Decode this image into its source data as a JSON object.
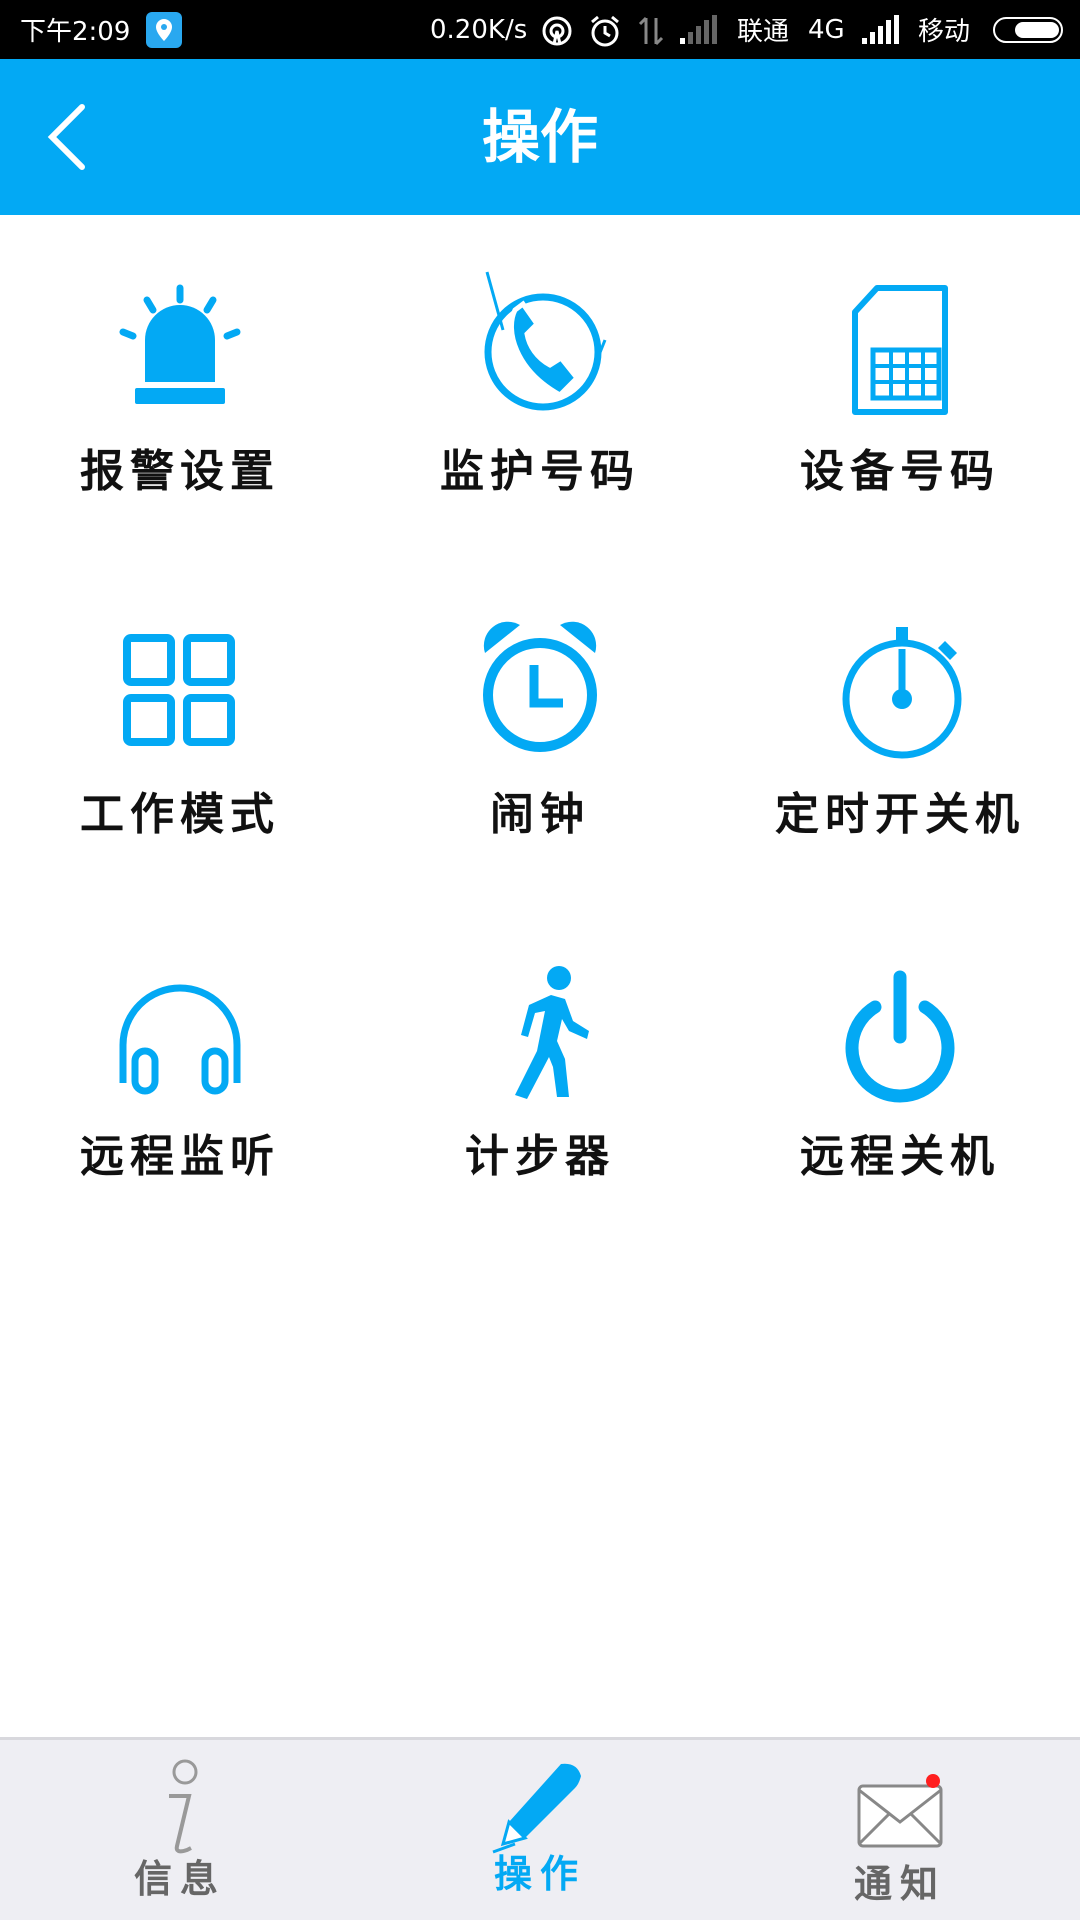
{
  "status_bar": {
    "time": "下午2:09",
    "speed": "0.20K/s",
    "carrier1": "联通",
    "network": "4G",
    "carrier2": "移动"
  },
  "header": {
    "title": "操作",
    "back_icon": "chevron-left-icon"
  },
  "colors": {
    "accent": "#03a9f4",
    "text": "#111111",
    "nav_inactive": "#666666",
    "badge": "#ff1f1f"
  },
  "grid": [
    {
      "label": "报警设置",
      "icon": "alarm-light-icon"
    },
    {
      "label": "监护号码",
      "icon": "phone-icon"
    },
    {
      "label": "设备号码",
      "icon": "sim-card-icon"
    },
    {
      "label": "工作模式",
      "icon": "grid-icon"
    },
    {
      "label": "闹钟",
      "icon": "alarm-clock-icon"
    },
    {
      "label": "定时开关机",
      "icon": "stopwatch-icon"
    },
    {
      "label": "远程监听",
      "icon": "headphones-icon"
    },
    {
      "label": "计步器",
      "icon": "walking-icon"
    },
    {
      "label": "远程关机",
      "icon": "power-icon"
    }
  ],
  "bottom_nav": [
    {
      "label": "信息",
      "icon": "info-icon",
      "active": false
    },
    {
      "label": "操作",
      "icon": "pencil-icon",
      "active": true
    },
    {
      "label": "通知",
      "icon": "envelope-icon",
      "active": false,
      "badge": true
    }
  ]
}
